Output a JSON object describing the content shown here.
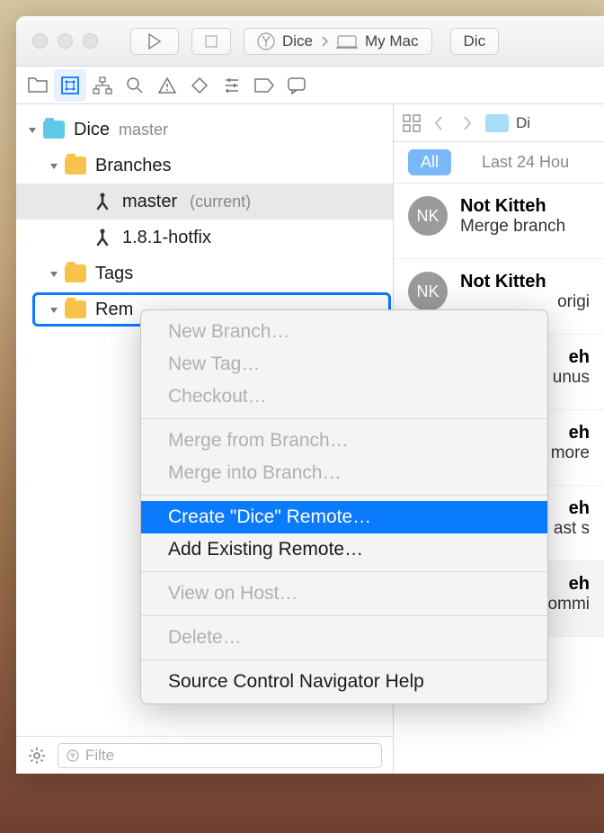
{
  "titlebar": {
    "scheme": "Dice",
    "destination": "My Mac",
    "right_button": "Dic"
  },
  "navigator": {
    "breadcrumb_label": "Di"
  },
  "tree": {
    "project": "Dice",
    "project_branch": "master",
    "branches_label": "Branches",
    "branches": [
      {
        "name": "master",
        "current": "(current)"
      },
      {
        "name": "1.8.1-hotfix",
        "current": ""
      }
    ],
    "tags_label": "Tags",
    "remotes_label": "Rem"
  },
  "sidebar_footer": {
    "filter_placeholder": "Filte"
  },
  "filter_bar": {
    "all": "All",
    "last24": "Last 24 Hou"
  },
  "commits": [
    {
      "initials": "NK",
      "author": "Not Kitteh",
      "msg": "Merge branch"
    },
    {
      "initials": "NK",
      "author": "Not Kitteh",
      "msg": "origi"
    },
    {
      "initials": "",
      "author": "eh",
      "msg": "unus"
    },
    {
      "initials": "",
      "author": "eh",
      "msg": "more"
    },
    {
      "initials": "",
      "author": "eh",
      "msg": "ast s"
    },
    {
      "initials": "",
      "author": "eh",
      "msg": "ommi"
    }
  ],
  "context_menu": {
    "new_branch": "New Branch…",
    "new_tag": "New Tag…",
    "checkout": "Checkout…",
    "merge_from": "Merge from Branch…",
    "merge_into": "Merge into Branch…",
    "create_remote": "Create \"Dice\" Remote…",
    "add_existing": "Add Existing Remote…",
    "view_on_host": "View on Host…",
    "delete": "Delete…",
    "help": "Source Control Navigator Help"
  }
}
